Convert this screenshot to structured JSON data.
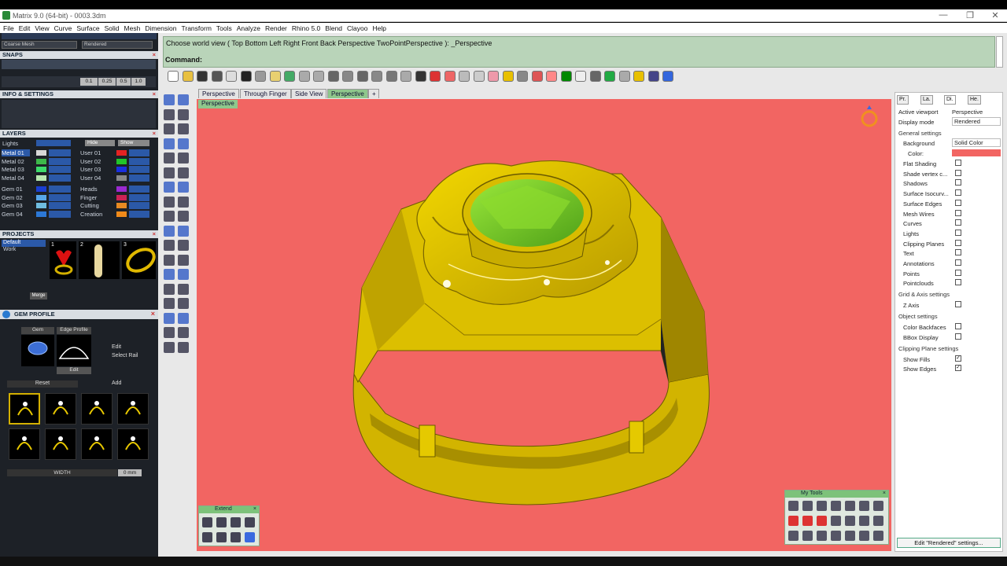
{
  "window": {
    "title": "Matrix 9.0 (64-bit) - 0003.3dm",
    "controls": [
      "—",
      "❐",
      "✕"
    ]
  },
  "menu": [
    "File",
    "Edit",
    "View",
    "Curve",
    "Surface",
    "Solid",
    "Mesh",
    "Dimension",
    "Transform",
    "Tools",
    "Analyze",
    "Render",
    "Rhino 5.0",
    "Blend",
    "Clayoo",
    "Help"
  ],
  "left_panel": {
    "mesh_dropdown": "Coarse Mesh",
    "render_dropdown": "Rendered",
    "snaps_title": "SNAPS",
    "snap_values": [
      "0.1",
      "0.25",
      "0.5",
      "1.0"
    ],
    "info_title": "INFO & SETTINGS",
    "layers_title": "LAYERS",
    "lights_label": "Lights",
    "hide_label": "Hide",
    "show_label": "Show",
    "layers_col1": [
      {
        "name": "Metal 01",
        "color": "#d7d7d7",
        "selected": true
      },
      {
        "name": "Metal 02",
        "color": "#3db84a",
        "selected": false
      },
      {
        "name": "Metal 03",
        "color": "#3ddb6a",
        "selected": false
      },
      {
        "name": "Metal 04",
        "color": "#b8e8b0",
        "selected": false
      },
      {
        "name": "Gem 01",
        "color": "#1a3fd0",
        "selected": false
      },
      {
        "name": "Gem 02",
        "color": "#57a6e8",
        "selected": false
      },
      {
        "name": "Gem 03",
        "color": "#6fbde0",
        "selected": false
      },
      {
        "name": "Gem 04",
        "color": "#2c78d6",
        "selected": false
      }
    ],
    "layers_col2": [
      {
        "name": "User 01",
        "color": "#e52222"
      },
      {
        "name": "User 02",
        "color": "#22c42a"
      },
      {
        "name": "User 03",
        "color": "#1a2fe0"
      },
      {
        "name": "User 04",
        "color": "#888888"
      },
      {
        "name": "Heads",
        "color": "#9a2ad0"
      },
      {
        "name": "Finger",
        "color": "#cc2255"
      },
      {
        "name": "Cutting",
        "color": "#e88a22"
      },
      {
        "name": "Creation",
        "color": "#f08a1a"
      }
    ],
    "projects_title": "PROJECTS",
    "projects": [
      "Default",
      "Work"
    ],
    "project_thumbs": [
      "1",
      "2",
      "3"
    ],
    "merge_label": "Merge",
    "gem_profile_title": "GEM PROFILE",
    "gem_label": "Gem",
    "edge_profile_label": "Edge Profile",
    "edit_label": "Edit",
    "edit2_label": "Edit",
    "select_rail_label": "Select Rail",
    "reset_label": "Reset",
    "add_label": "Add",
    "width_label": "WIDTH",
    "width_value": "0 mm"
  },
  "command": {
    "prompt": "Choose world view ( Top  Bottom  Left  Right  Front  Back  Perspective  TwoPointPerspective ): _Perspective",
    "label": "Command:"
  },
  "view_tabs": [
    "Perspective",
    "Through Finger",
    "Side View",
    "Perspective"
  ],
  "viewport": {
    "label": "Perspective",
    "background": "#f26562",
    "metal_color": "#e8c800",
    "gem_color": "#7ed321"
  },
  "properties": {
    "tabs": [
      "Pr.",
      "La.",
      "Di.",
      "He."
    ],
    "active_viewport_label": "Active viewport",
    "active_viewport_value": "Perspective",
    "display_mode_label": "Display mode",
    "display_mode_value": "Rendered",
    "general_section": "General settings",
    "background_label": "Background",
    "background_value": "Solid Color",
    "color_label": "Color:",
    "color_swatch": "#f26562",
    "checks": [
      {
        "label": "Flat Shading",
        "checked": false
      },
      {
        "label": "Shade vertex c...",
        "checked": false
      },
      {
        "label": "Shadows",
        "checked": false
      },
      {
        "label": "Surface Isocurv...",
        "checked": false
      },
      {
        "label": "Surface Edges",
        "checked": false
      },
      {
        "label": "Mesh Wires",
        "checked": false
      },
      {
        "label": "Curves",
        "checked": false
      },
      {
        "label": "Lights",
        "checked": false
      },
      {
        "label": "Clipping Planes",
        "checked": false
      },
      {
        "label": "Text",
        "checked": false
      },
      {
        "label": "Annotations",
        "checked": false
      },
      {
        "label": "Points",
        "checked": false
      },
      {
        "label": "Pointclouds",
        "checked": false
      }
    ],
    "grid_section": "Grid & Axis settings",
    "z_axis_label": "Z Axis",
    "object_section": "Object settings",
    "color_backfaces_label": "Color Backfaces",
    "bbox_label": "BBox Display",
    "clipping_section": "Clipping Plane settings",
    "show_fills_label": "Show Fills",
    "show_edges_label": "Show Edges",
    "edit_button": "Edit \"Rendered\" settings..."
  },
  "floating": {
    "extend_title": "Extend",
    "mytools_title": "My Tools"
  }
}
